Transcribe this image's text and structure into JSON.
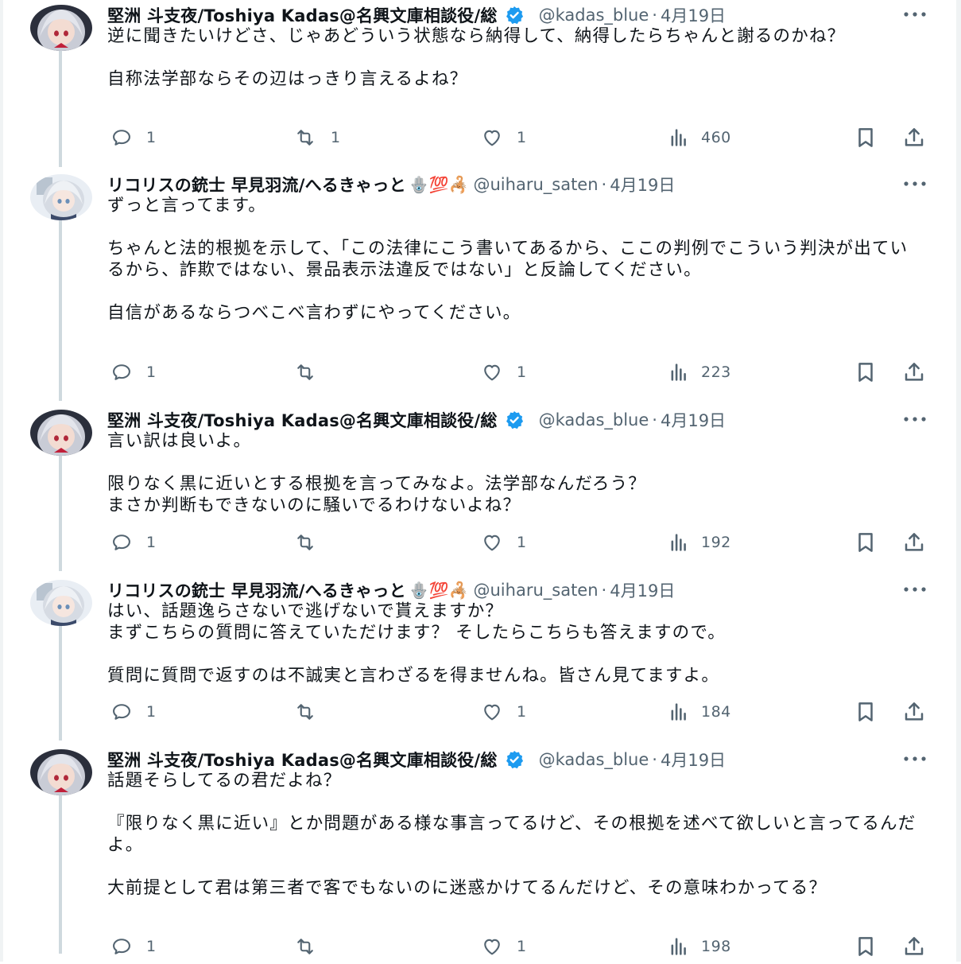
{
  "tweets": [
    {
      "name": "堅洲 斗支夜/Toshiya Kadas@名興文庫相談役/総",
      "verified": true,
      "emoji": "",
      "handle": "@kadas_blue",
      "date": "4月19日",
      "paragraphs": [
        "逆に聞きたいけどさ、じゃあどういう状態なら納得して、納得したらちゃんと謝るのかね？",
        "自称法学部ならその辺はっきり言えるよね？"
      ],
      "replies": "1",
      "retweets": "1",
      "likes": "1",
      "views": "460",
      "avatar_icon": "anime-avatar-icon"
    },
    {
      "name": "リコリスの銃士 早見羽流/へるきゃっと",
      "verified": false,
      "emoji": "🪬💯🦂",
      "handle": "@uiharu_saten",
      "date": "4月19日",
      "paragraphs": [
        "ずっと言ってます。",
        "ちゃんと法的根拠を示して、「この法律にこう書いてあるから、ここの判例でこういう判決が出ているから、詐欺ではない、景品表示法違反ではない」と反論してください。",
        "自信があるならつべこべ言わずにやってください。"
      ],
      "replies": "1",
      "retweets": "",
      "likes": "1",
      "views": "223",
      "avatar_icon": "anime-avatar-icon"
    },
    {
      "name": "堅洲 斗支夜/Toshiya Kadas@名興文庫相談役/総",
      "verified": true,
      "emoji": "",
      "handle": "@kadas_blue",
      "date": "4月19日",
      "paragraphs": [
        "言い訳は良いよ。",
        "限りなく黒に近いとする根拠を言ってみなよ。法学部なんだろう？\nまさか判断もできないのに騒いでるわけないよね？"
      ],
      "replies": "1",
      "retweets": "",
      "likes": "1",
      "views": "192",
      "avatar_icon": "anime-avatar-icon"
    },
    {
      "name": "リコリスの銃士 早見羽流/へるきゃっと",
      "verified": false,
      "emoji": "🪬💯🦂",
      "handle": "@uiharu_saten",
      "date": "4月19日",
      "paragraphs": [
        "はい、話題逸らさないで逃げないで貰えますか？\nまずこちらの質問に答えていただけます？ そしたらこちらも答えますので。",
        "質問に質問で返すのは不誠実と言わざるを得ませんね。皆さん見てますよ。"
      ],
      "replies": "1",
      "retweets": "",
      "likes": "1",
      "views": "184",
      "avatar_icon": "anime-avatar-icon"
    },
    {
      "name": "堅洲 斗支夜/Toshiya Kadas@名興文庫相談役/総",
      "verified": true,
      "emoji": "",
      "handle": "@kadas_blue",
      "date": "4月19日",
      "paragraphs": [
        "話題そらしてるの君だよね？",
        "『限りなく黒に近い』とか問題がある様な事言ってるけど、その根拠を述べて欲しいと言ってるんだよ。",
        "大前提として君は第三者で客でもないのに迷惑かけてるんだけど、その意味わかってる？"
      ],
      "replies": "1",
      "retweets": "",
      "likes": "1",
      "views": "198",
      "avatar_icon": "anime-avatar-icon"
    }
  ],
  "colors": {
    "text": "#0f1419",
    "secondary": "#536471",
    "verified": "#1d9bf0",
    "thread_line": "#cfd9de"
  },
  "icons": {
    "reply": "reply-icon",
    "retweet": "retweet-icon",
    "like": "like-icon",
    "views": "views-icon",
    "bookmark": "bookmark-icon",
    "share": "share-icon",
    "more": "more-icon",
    "verified": "verified-badge-icon"
  }
}
